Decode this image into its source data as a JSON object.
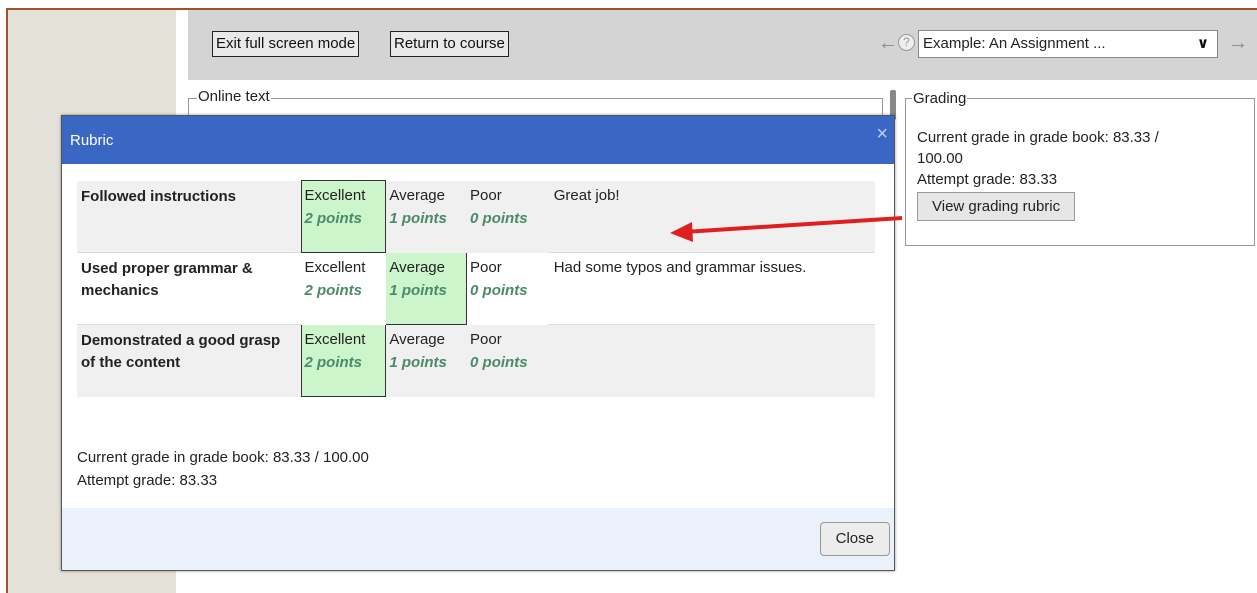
{
  "toolbar": {
    "exit_fullscreen": "Exit full screen mode",
    "return_to_course": "Return to course",
    "help_glyph": "?",
    "select_value": "Example: An Assignment ..."
  },
  "online_text": {
    "legend": "Online text"
  },
  "grading": {
    "legend": "Grading",
    "current_grade_line1": "Current grade in grade book: 83.33 /",
    "current_grade_line2": "100.00",
    "attempt_grade": "Attempt grade: 83.33",
    "view_rubric_button": "View grading rubric"
  },
  "modal": {
    "title": "Rubric",
    "close_x": "×",
    "criteria": [
      {
        "name": "Followed instructions",
        "levels": [
          {
            "label": "Excellent",
            "points": "2 points"
          },
          {
            "label": "Average",
            "points": "1 points"
          },
          {
            "label": "Poor",
            "points": "0 points"
          }
        ],
        "selected": 0,
        "feedback": "Great job!"
      },
      {
        "name": "Used proper grammar & mechanics",
        "levels": [
          {
            "label": "Excellent",
            "points": "2 points"
          },
          {
            "label": "Average",
            "points": "1 points"
          },
          {
            "label": "Poor",
            "points": "0 points"
          }
        ],
        "selected": 1,
        "feedback": "Had some typos and grammar issues."
      },
      {
        "name": "Demonstrated a good grasp of the content",
        "levels": [
          {
            "label": "Excellent",
            "points": "2 points"
          },
          {
            "label": "Average",
            "points": "1 points"
          },
          {
            "label": "Poor",
            "points": "0 points"
          }
        ],
        "selected": 0,
        "feedback": ""
      }
    ],
    "current_grade": "Current grade in grade book: 83.33 / 100.00",
    "attempt_grade": "Attempt grade: 83.33",
    "close_button": "Close"
  },
  "colors": {
    "modal_header": "#3a66c4",
    "selected_level": "#ccf5cc",
    "points_text": "#4a8a6a",
    "annotation_arrow": "#e02020"
  },
  "icons": [
    "back-arrow-icon",
    "help-icon",
    "chevron-down-icon",
    "forward-arrow-icon",
    "close-icon"
  ]
}
